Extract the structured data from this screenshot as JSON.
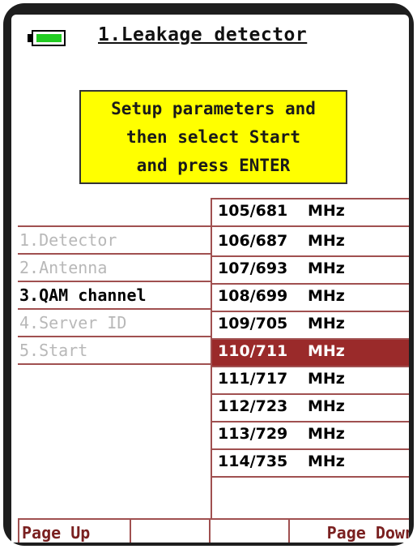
{
  "header": {
    "title": "1.Leakage detector",
    "battery_icon": "battery-icon",
    "battery_level": 0.85
  },
  "message": {
    "line1": "Setup parameters and",
    "line2": "then select Start",
    "line3": "and press ENTER"
  },
  "menu": {
    "items": [
      {
        "label": "1.Detector",
        "state": "disabled"
      },
      {
        "label": "2.Antenna",
        "state": "disabled"
      },
      {
        "label": "3.QAM channel",
        "state": "active"
      },
      {
        "label": "4.Server ID",
        "state": "disabled"
      },
      {
        "label": "5.Start",
        "state": "disabled"
      }
    ]
  },
  "frequencies": {
    "unit": "MHz",
    "selected_index": 5,
    "items": [
      "105/681",
      "106/687",
      "107/693",
      "108/699",
      "109/705",
      "110/711",
      "111/717",
      "112/723",
      "113/729",
      "114/735"
    ]
  },
  "softkeys": {
    "page_up": "Page Up",
    "key2": "",
    "key3": "",
    "page_down": "Page Down"
  },
  "colors": {
    "message_bg": "#ffff00",
    "battery": "#22cc22",
    "selection": "#9a2a2a",
    "grid": "#a05050",
    "disabled_text": "#b8b8b8"
  }
}
